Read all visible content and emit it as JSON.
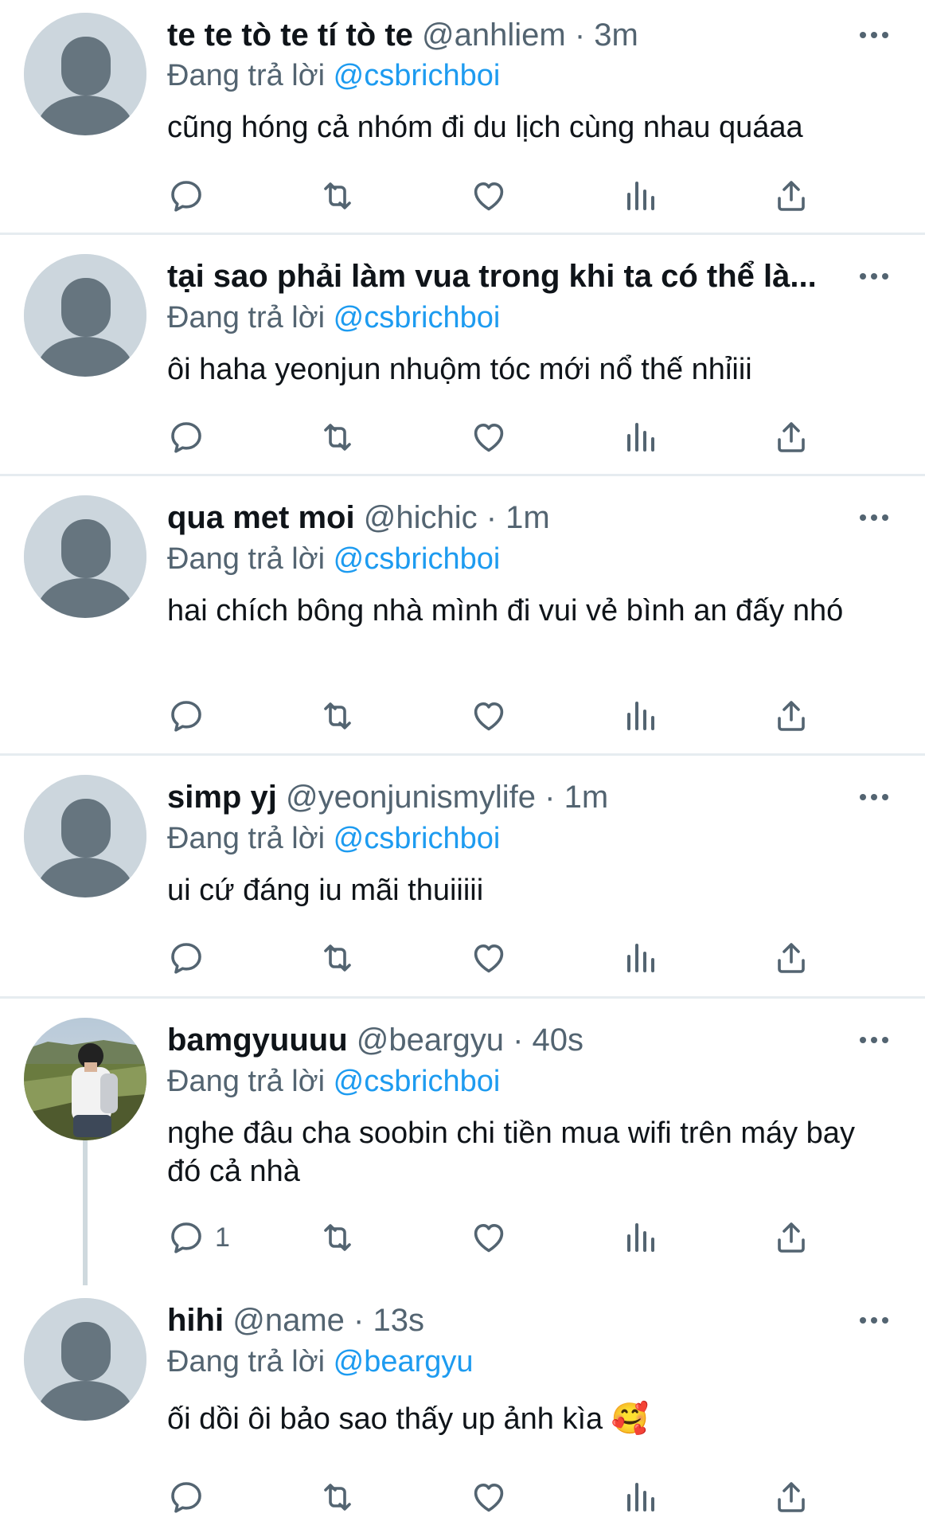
{
  "labels": {
    "replying_prefix": "Đang trả lời",
    "separator": "·"
  },
  "colors": {
    "link": "#1d9bf0",
    "secondary_text": "#536471",
    "icon": "#536471",
    "avatar_placeholder": "#ccd6dd",
    "avatar_silhouette": "#66757f",
    "divider": "#e6ecf0"
  },
  "tweets": [
    {
      "name": "te te tò te tí tò te",
      "handle": "@anhliem",
      "time": "3m",
      "reply_to": "@csbrichboi",
      "text": "cũng hóng cả nhóm đi du lịch cùng nhau quáaa",
      "reply_count": "",
      "avatar": "default-avatar"
    },
    {
      "name": "tại sao phải làm vua trong khi ta có thể là...",
      "handle": "",
      "time": "",
      "reply_to": "@csbrichboi",
      "text": "ôi haha yeonjun nhuộm tóc mới nổ thế nhỉiii",
      "reply_count": "",
      "avatar": "default-avatar"
    },
    {
      "name": "qua met moi",
      "handle": "@hichic",
      "time": "1m",
      "reply_to": "@csbrichboi",
      "text": "hai chích bông nhà mình đi vui vẻ bình an đấy nhó",
      "reply_count": "",
      "avatar": "default-avatar"
    },
    {
      "name": "simp yj",
      "handle": "@yeonjunismylife",
      "time": "1m",
      "reply_to": "@csbrichboi",
      "text": "ui cứ đáng iu mãi thuiiiii",
      "reply_count": "",
      "avatar": "default-avatar"
    },
    {
      "name": "bamgyuuuu",
      "handle": "@beargyu",
      "time": "40s",
      "reply_to": "@csbrichboi",
      "text": "nghe đâu cha soobin chi tiền mua wifi trên máy bay đó cả nhà",
      "reply_count": "1",
      "avatar": "photo-avatar"
    },
    {
      "name": "hihi",
      "handle": "@name",
      "time": "13s",
      "reply_to": "@beargyu",
      "text": "ối dồi ôi bảo sao thấy up ảnh kìa",
      "emoji": "🥰",
      "reply_count": "",
      "avatar": "default-avatar"
    }
  ]
}
